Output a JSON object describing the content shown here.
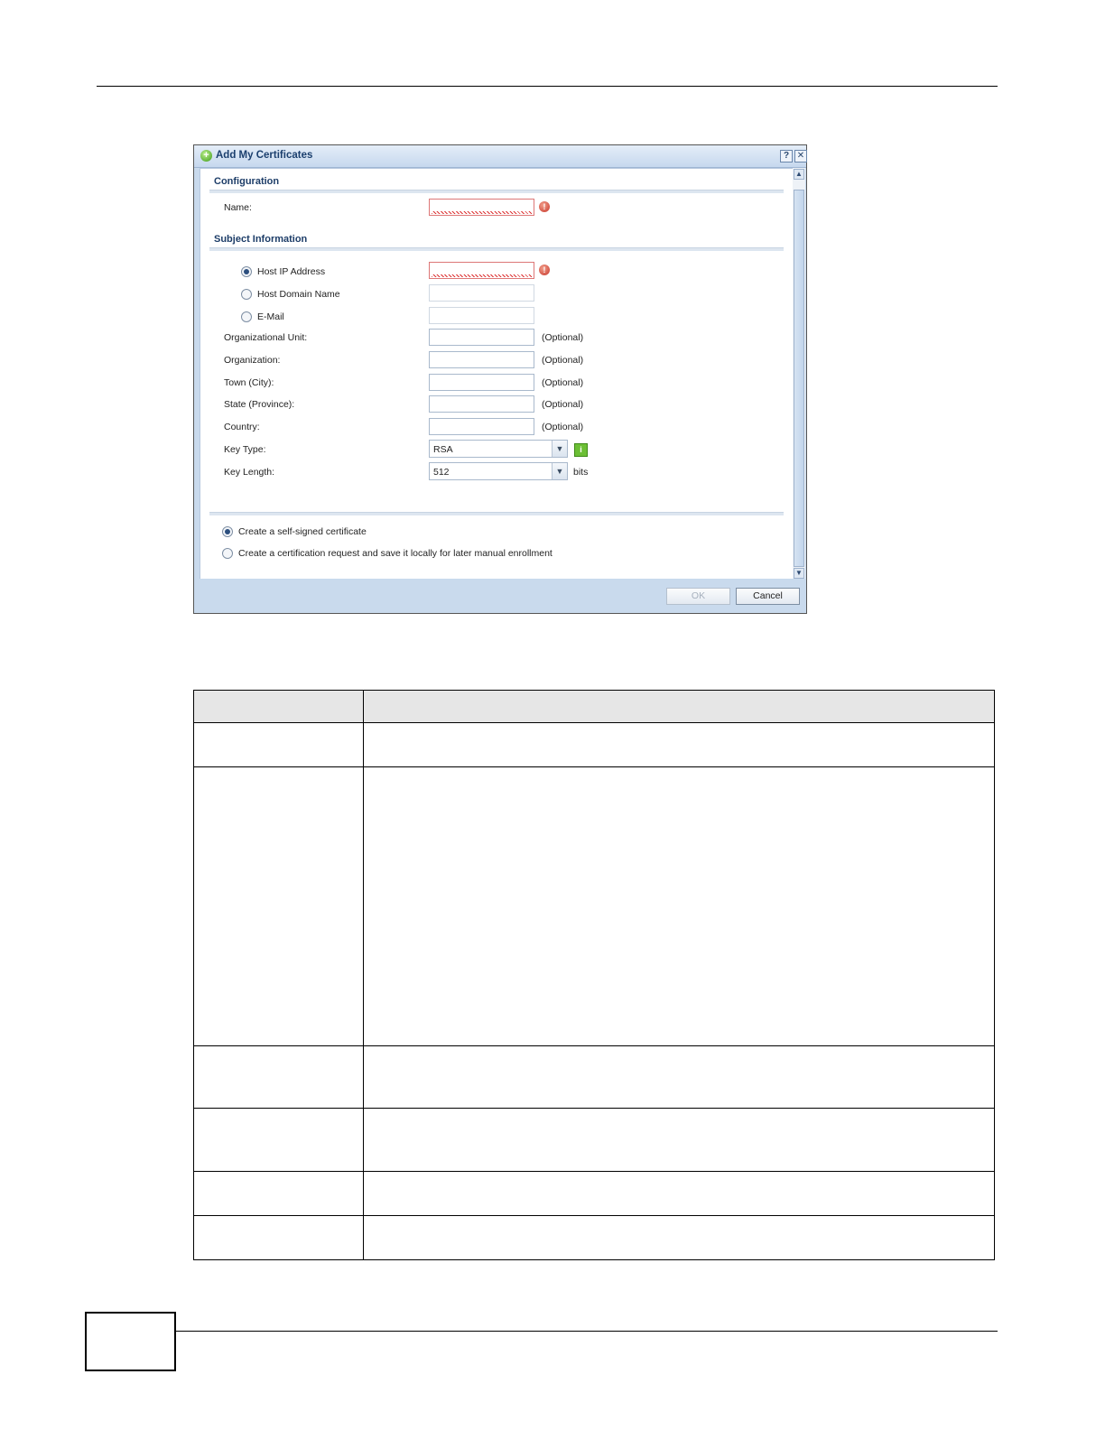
{
  "dialog": {
    "title": "Add My Certificates",
    "help_glyph": "?",
    "close_glyph": "✕",
    "sections": {
      "configuration": "Configuration",
      "subject": "Subject Information"
    },
    "name": {
      "label": "Name:"
    },
    "subject_options": [
      {
        "label": "Host IP Address",
        "selected": true
      },
      {
        "label": "Host Domain Name",
        "selected": false
      },
      {
        "label": "E-Mail",
        "selected": false
      }
    ],
    "optional_fields": [
      {
        "label": "Organizational Unit:",
        "note": "(Optional)"
      },
      {
        "label": "Organization:",
        "note": "(Optional)"
      },
      {
        "label": "Town (City):",
        "note": "(Optional)"
      },
      {
        "label": "State (Province):",
        "note": "(Optional)"
      },
      {
        "label": "Country:",
        "note": "(Optional)"
      }
    ],
    "key_type": {
      "label": "Key Type:",
      "value": "RSA"
    },
    "key_length": {
      "label": "Key Length:",
      "value": "512",
      "unit": "bits"
    },
    "enroll_options": [
      {
        "label": "Create a self-signed certificate",
        "selected": true
      },
      {
        "label": "Create a certification request and save it locally for later manual enrollment",
        "selected": false
      }
    ],
    "buttons": {
      "ok": "OK",
      "cancel": "Cancel"
    }
  },
  "colors": {
    "title_text": "#1b3f6e",
    "dialog_bg": "#c9daed",
    "error_red": "#c6362b",
    "info_green": "#6cbf35"
  }
}
